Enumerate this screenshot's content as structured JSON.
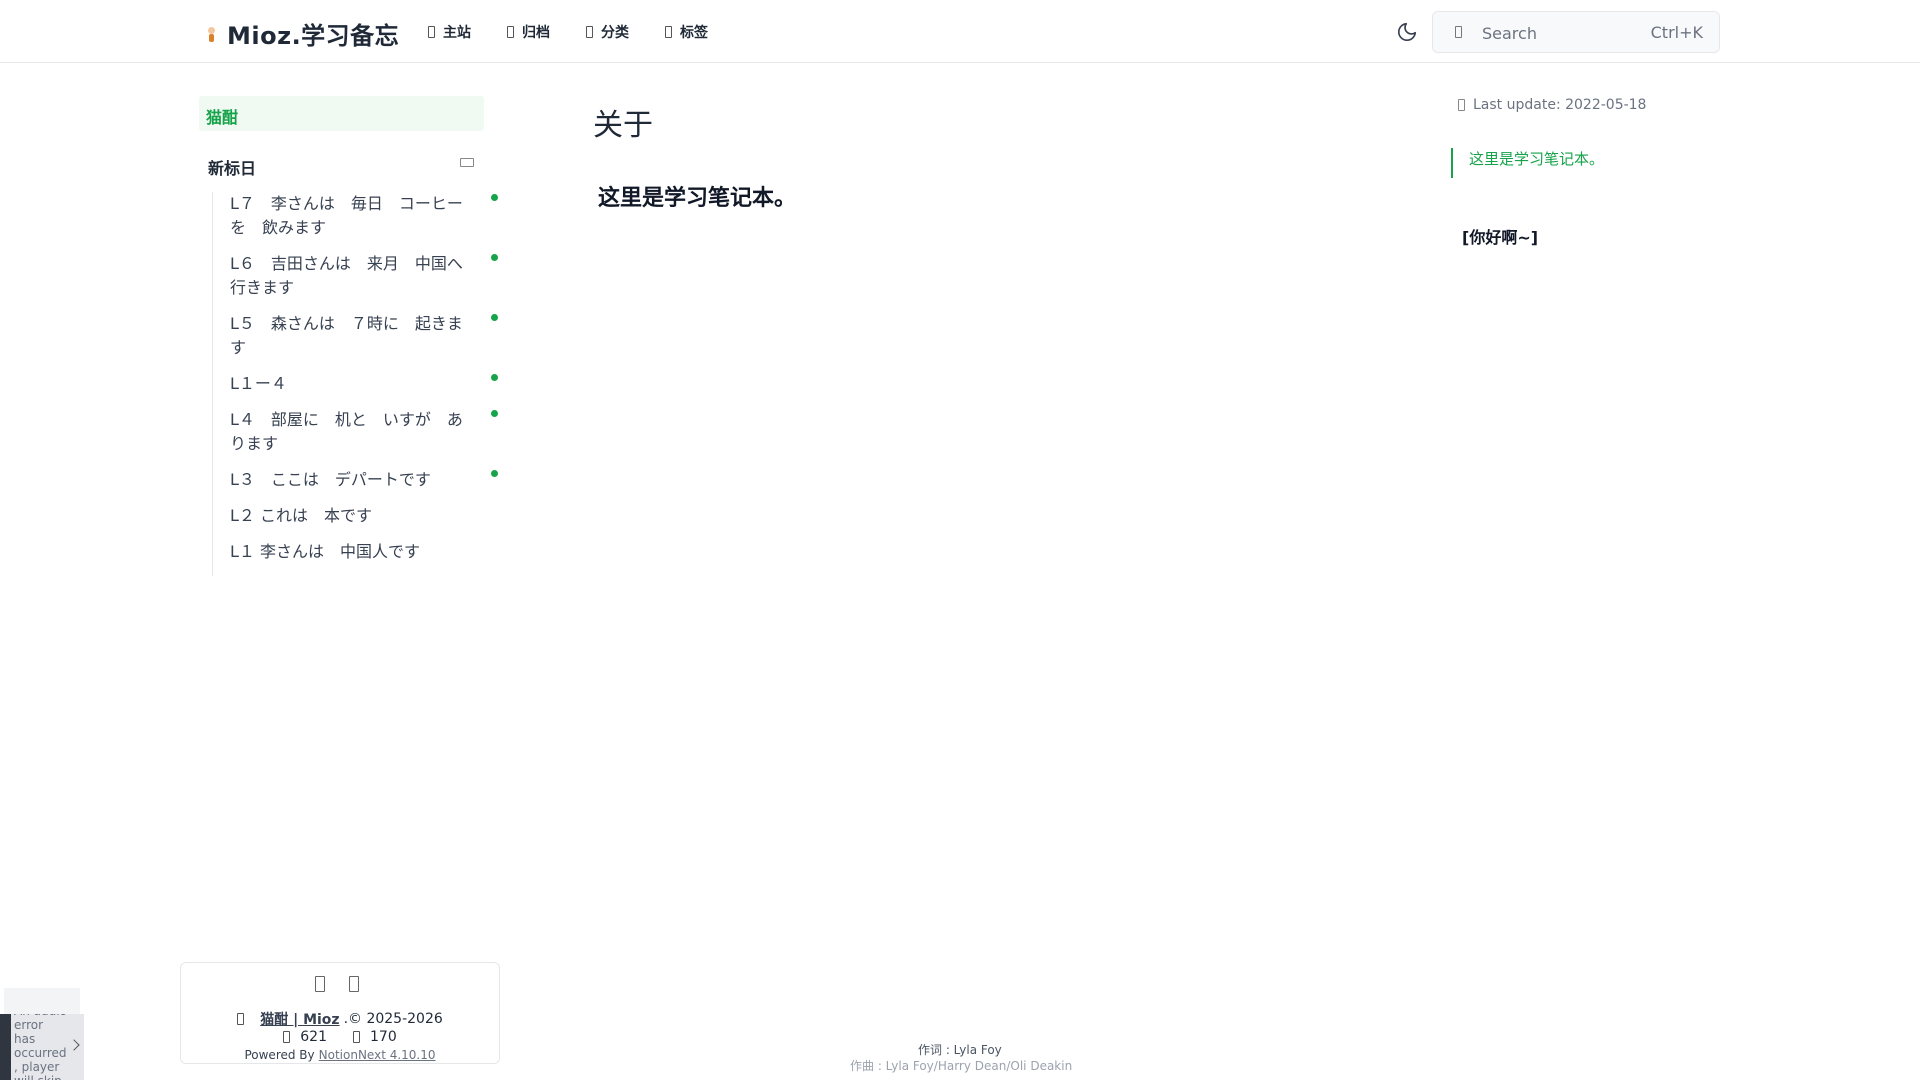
{
  "header": {
    "site_title": "Mioz.学习备忘",
    "nav": [
      {
        "label": "主站",
        "icon": "home-icon"
      },
      {
        "label": "归档",
        "icon": "archive-icon"
      },
      {
        "label": "分类",
        "icon": "folder-icon"
      },
      {
        "label": "标签",
        "icon": "tag-icon"
      }
    ],
    "search": {
      "placeholder": "Search",
      "shortcut": "Ctrl+K"
    }
  },
  "sidebar": {
    "head": "猫酣",
    "group_title": "新标日",
    "items": [
      {
        "label": "L７　李さんは　毎日　コーヒーを　飲みます",
        "dot": true
      },
      {
        "label": "L６　吉田さんは　来月　中国へ行きます",
        "dot": true
      },
      {
        "label": "L５　森さんは　７時に　起きます",
        "dot": true
      },
      {
        "label": "L１ー４",
        "dot": true
      },
      {
        "label": "L４　部屋に　机と　いすが　あります",
        "dot": true
      },
      {
        "label": "L３　ここは　デパートです",
        "dot": true
      },
      {
        "label": "L２ これは　本です",
        "dot": false
      },
      {
        "label": "L１ 李さんは　中国人です",
        "dot": false
      }
    ]
  },
  "main": {
    "title": "关于",
    "text": "这里是学习笔记本。"
  },
  "toc": {
    "last_update": "Last update: 2022-05-18",
    "items": [
      "这里是学习笔记本。"
    ],
    "greeting": "你好啊~"
  },
  "footer": {
    "site_link": "猫酣 | Mioz",
    "copyright": ".© 2025-2026",
    "pv": "621",
    "uv": "170",
    "powered_by": "Powered By",
    "powered_link": "NotionNext 4.10.10"
  },
  "lyrics": {
    "line1": "作词 : Lyla Foy",
    "line2": "作曲 : Lyla Foy/Harry Dean/Oli Deakin"
  },
  "player": {
    "error": "An audio error has occurred, player will skip forward"
  },
  "colors": {
    "accent": "#16a34a",
    "sidebar_head_bg": "#f0faf3"
  }
}
